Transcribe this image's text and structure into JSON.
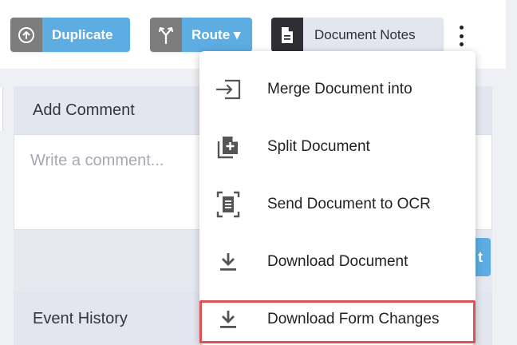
{
  "toolbar": {
    "duplicate": {
      "label": "Duplicate",
      "icon": "upload-circle-icon"
    },
    "route": {
      "label": "Route ▾",
      "icon": "route-fork-icon"
    },
    "notes": {
      "label": "Document Notes",
      "icon": "document-icon"
    },
    "more_icon": "kebab-icon"
  },
  "comment": {
    "header": "Add Comment",
    "placeholder": "Write a comment...",
    "submit_label": "t"
  },
  "history": {
    "header": "Event History"
  },
  "menu": {
    "items": [
      {
        "label": "Merge Document into",
        "icon": "merge-icon"
      },
      {
        "label": "Split Document",
        "icon": "split-document-icon"
      },
      {
        "label": "Send Document to OCR",
        "icon": "ocr-scan-icon"
      },
      {
        "label": "Download Document",
        "icon": "download-icon"
      },
      {
        "label": "Download Form Changes",
        "icon": "download-icon"
      }
    ],
    "highlighted_index": 4
  },
  "colors": {
    "accent": "#5dade2",
    "icon_gray": "#7d7d7d",
    "dark_icon": "#2f2f33",
    "highlight": "#e05050"
  }
}
